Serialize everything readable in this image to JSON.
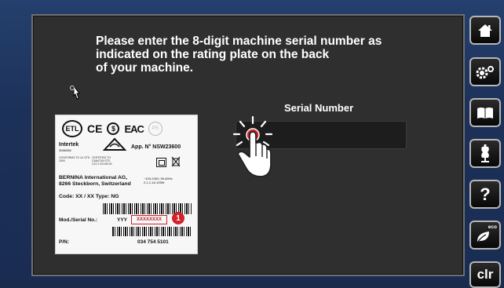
{
  "instruction": {
    "line1": "Please enter the  8-digit machine serial number as",
    "line2": "indicated on the rating plate on the back",
    "line3": "of your machine."
  },
  "serial": {
    "label": "Serial Number",
    "value": ""
  },
  "plate": {
    "cert_etl": "ETL",
    "cert_ce": "CE",
    "cert_eac": "EAC",
    "intertek": "Intertek",
    "intertek_num": "3066058",
    "intertek_note": "CONFORMS TO UL STD 1594",
    "intertek_note2": "CERTIFIED TO CAN/CSA STD C22.2 NO.68-09",
    "app_nr": "App. N° NSW23600",
    "company": "BERNINA International AG,",
    "address": "8266 Steckborn, Switzerland",
    "voltage": "~100-240V, 50-60Hz",
    "voltage2": "2,1-1,1A 125W",
    "code": "Code: XX / XX Type: NG",
    "mod_serial_label": "Mod./Serial No.:",
    "serial_prefix": "YYY",
    "serial_placeholder": "XXXXXXXX",
    "badge": "1",
    "pn_label": "P/N:",
    "pn_value": "034 754 5101"
  },
  "sidebar": {
    "buttons": [
      {
        "name": "home",
        "icon": "home-icon"
      },
      {
        "name": "settings",
        "icon": "settings-icon"
      },
      {
        "name": "guide",
        "icon": "book-icon"
      },
      {
        "name": "tutorial",
        "icon": "dress-form-icon"
      },
      {
        "name": "help",
        "icon": "question-icon",
        "label": "?"
      },
      {
        "name": "eco",
        "icon": "eco-icon",
        "label": "eco"
      },
      {
        "name": "clear",
        "icon": "clr-icon",
        "label": "clr"
      }
    ]
  },
  "colors": {
    "frame": "#1c3159",
    "screen": "#2f2f2f",
    "accent": "#d2232a"
  }
}
